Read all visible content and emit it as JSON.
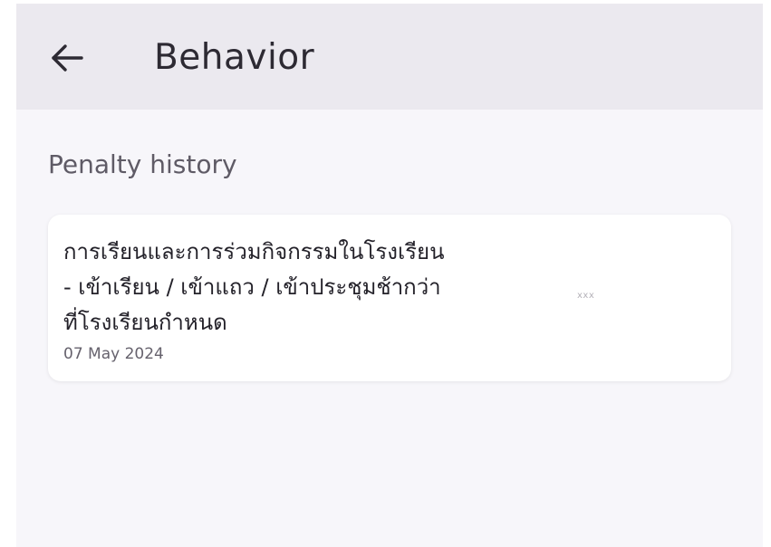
{
  "header": {
    "back_icon": "arrow-left-icon",
    "title": "Behavior"
  },
  "section": {
    "title": "Penalty history"
  },
  "penalties": [
    {
      "description_lines": [
        "การเรียนและการร่วมกิจกรรมในโรงเรียน",
        "- เข้าเรียน / เข้าแถว / เข้าประชุมช้ากว่า",
        "ที่โรงเรียนกำหนด"
      ],
      "date": "07 May 2024",
      "points": "xxx"
    }
  ],
  "colors": {
    "app_bar": "#ebe9ef",
    "page_background": "#f7f6fa",
    "card_background": "#ffffff",
    "title_text": "#2d2a33",
    "section_text": "#5f5b66",
    "body_text": "#24222a",
    "date_text": "#66626d",
    "points_text": "#b4b1b8"
  }
}
